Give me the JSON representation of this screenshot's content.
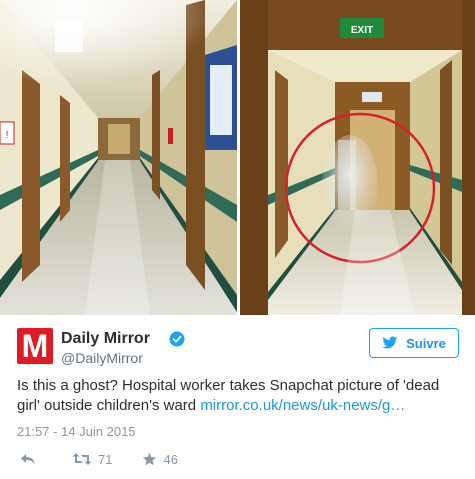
{
  "photos": {
    "left": {
      "sign_text": "!"
    },
    "right": {
      "exit_sign_text": "EXIT"
    }
  },
  "tweet": {
    "author_name": "Daily Mirror",
    "author_handle": "@DailyMirror",
    "logo_letter": "M",
    "follow_label": "Suivre",
    "text": "Is this a ghost? Hospital worker takes Snapchat picture of 'dead girl' outside children's ward ",
    "link_text": "mirror.co.uk/news/uk-news/g…",
    "timestamp": "21:57 - 14 Juin 2015",
    "retweets": "71",
    "likes": "46"
  },
  "colors": {
    "brand_red": "#e01a22",
    "twitter_blue": "#1da1f2",
    "ghost_circle": "#d6202a"
  },
  "icons": [
    "verified-icon",
    "twitter-bird-icon",
    "reply-icon",
    "retweet-icon",
    "like-star-icon"
  ]
}
